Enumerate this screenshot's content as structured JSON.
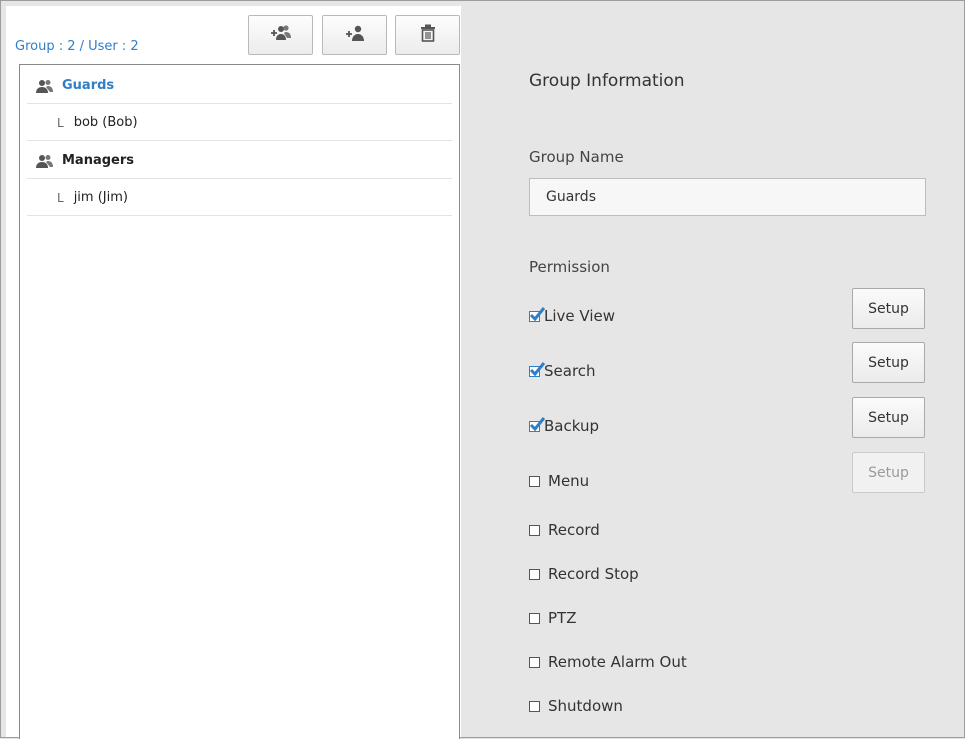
{
  "summary": {
    "count_text": "Group : 2 / User : 2"
  },
  "toolbar": {
    "add_group_icon": "add-group-icon",
    "add_user_icon": "add-user-icon",
    "delete_icon": "trash-icon"
  },
  "tree": {
    "groups": [
      {
        "label": "Guards",
        "selected": true,
        "users": [
          {
            "label": "bob (Bob)"
          }
        ]
      },
      {
        "label": "Managers",
        "selected": false,
        "users": [
          {
            "label": "jim (Jim)"
          }
        ]
      }
    ],
    "branch_glyph": "L"
  },
  "details": {
    "title": "Group Information",
    "group_name_label": "Group Name",
    "group_name_value": "Guards",
    "permission_label": "Permission",
    "setup_label": "Setup",
    "permissions": [
      {
        "label": "Live View",
        "checked": true,
        "has_setup": true,
        "setup_enabled": true
      },
      {
        "label": "Search",
        "checked": true,
        "has_setup": true,
        "setup_enabled": true
      },
      {
        "label": "Backup",
        "checked": true,
        "has_setup": true,
        "setup_enabled": true
      },
      {
        "label": "Menu",
        "checked": false,
        "has_setup": true,
        "setup_enabled": false
      },
      {
        "label": "Record",
        "checked": false,
        "has_setup": false
      },
      {
        "label": "Record Stop",
        "checked": false,
        "has_setup": false
      },
      {
        "label": "PTZ",
        "checked": false,
        "has_setup": false
      },
      {
        "label": "Remote Alarm Out",
        "checked": false,
        "has_setup": false
      },
      {
        "label": "Shutdown",
        "checked": false,
        "has_setup": false
      }
    ]
  },
  "colors": {
    "accent": "#2f7fc6",
    "panel_bg": "#e6e6e6",
    "tree_bg": "#ffffff"
  }
}
